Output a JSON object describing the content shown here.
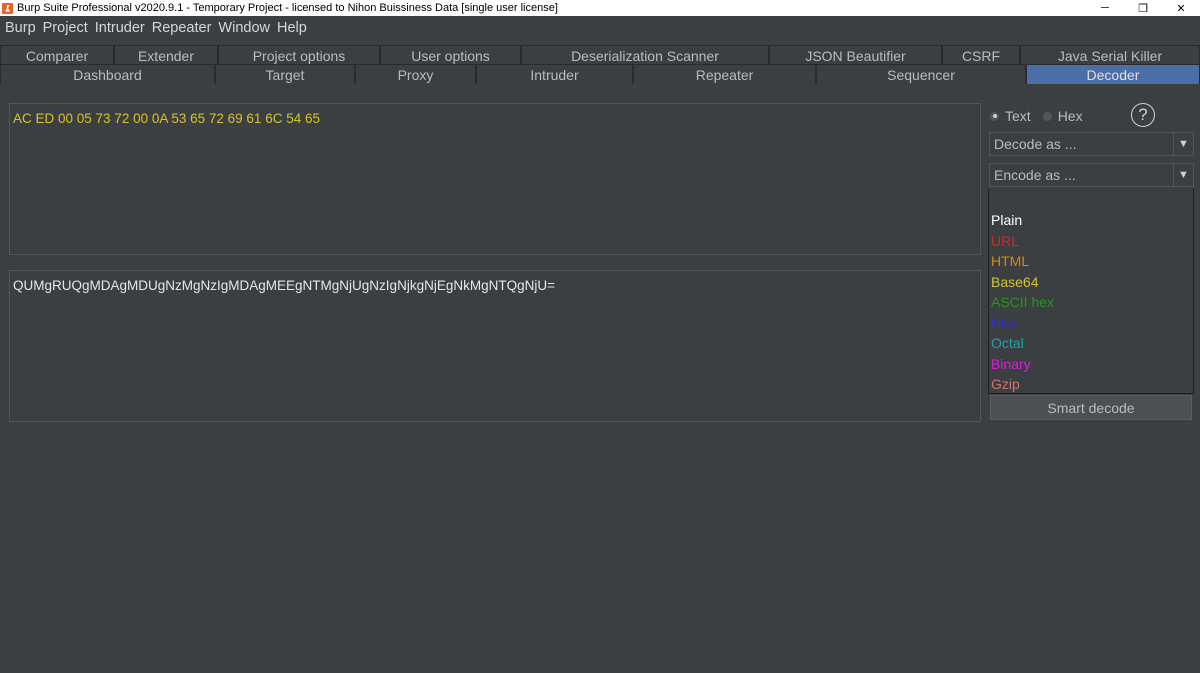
{
  "window": {
    "title": "Burp Suite Professional v2020.9.1 - Temporary Project - licensed to Nihon Buissiness Data [single user license]",
    "minimize": "─",
    "restore": "❐",
    "close": "✕"
  },
  "menu": [
    "Burp",
    "Project",
    "Intruder",
    "Repeater",
    "Window",
    "Help"
  ],
  "tabs_row1": [
    "Comparer",
    "Extender",
    "Project options",
    "User options",
    "Deserialization Scanner",
    "JSON Beautifier",
    "CSRF",
    "Java Serial Killer"
  ],
  "tabs_row2": [
    "Dashboard",
    "Target",
    "Proxy",
    "Intruder",
    "Repeater",
    "Sequencer",
    "Decoder"
  ],
  "active_tab": "Decoder",
  "decoder": {
    "input_text": "AC ED 00 05 73 72 00 0A 53 65 72 69 61 6C 54 65",
    "output_text": "QUMgRUQgMDAgMDUgNzMgNzIgMDAgMEEgNTMgNjUgNzIgNjkgNjEgNkMgNTQgNjU=",
    "radio_text": "Text",
    "radio_hex": "Hex",
    "help": "?",
    "decode_as": "Decode as ...",
    "encode_as": "Encode as ...",
    "dropdown_arrow": "▼",
    "encode_options": [
      {
        "label": "Plain",
        "color": "#ffffff"
      },
      {
        "label": "URL",
        "color": "#e02424"
      },
      {
        "label": "HTML",
        "color": "#d08a14"
      },
      {
        "label": "Base64",
        "color": "#d4c42a"
      },
      {
        "label": "ASCII hex",
        "color": "#1f9a1f"
      },
      {
        "label": "Hex",
        "color": "#2b2bf0"
      },
      {
        "label": "Octal",
        "color": "#1aa3a3"
      },
      {
        "label": "Binary",
        "color": "#d81fd8"
      },
      {
        "label": "Gzip",
        "color": "#d07070"
      }
    ],
    "smart_decode": "Smart decode"
  }
}
